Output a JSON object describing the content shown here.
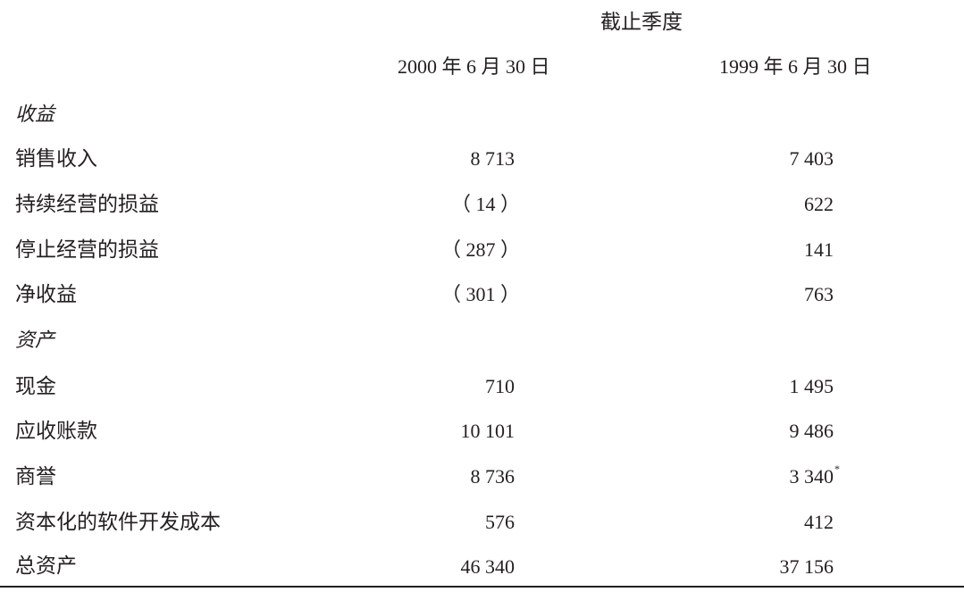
{
  "header": {
    "period_label": "截止季度",
    "col1": "2000 年 6 月 30 日",
    "col2": "1999 年 6 月 30 日"
  },
  "sections": {
    "revenue": "收益",
    "assets": "资产"
  },
  "rows": [
    {
      "label": "销售收入",
      "v1": "8 713",
      "v2": "7 403"
    },
    {
      "label": "持续经营的损益",
      "v1": "（ 14 ）",
      "v2": "622"
    },
    {
      "label": "停止经营的损益",
      "v1": "（ 287 ）",
      "v2": "141"
    },
    {
      "label": "净收益",
      "v1": "（ 301 ）",
      "v2": "763"
    },
    {
      "label": "现金",
      "v1": "710",
      "v2": "1 495"
    },
    {
      "label": "应收账款",
      "v1": "10 101",
      "v2": "9 486"
    },
    {
      "label": "商誉",
      "v1": "8 736",
      "v2": "3 340",
      "v2_note": "*"
    },
    {
      "label": "资本化的软件开发成本",
      "v1": "576",
      "v2": "412"
    },
    {
      "label": "总资产",
      "v1": "46 340",
      "v2": "37 156"
    }
  ]
}
